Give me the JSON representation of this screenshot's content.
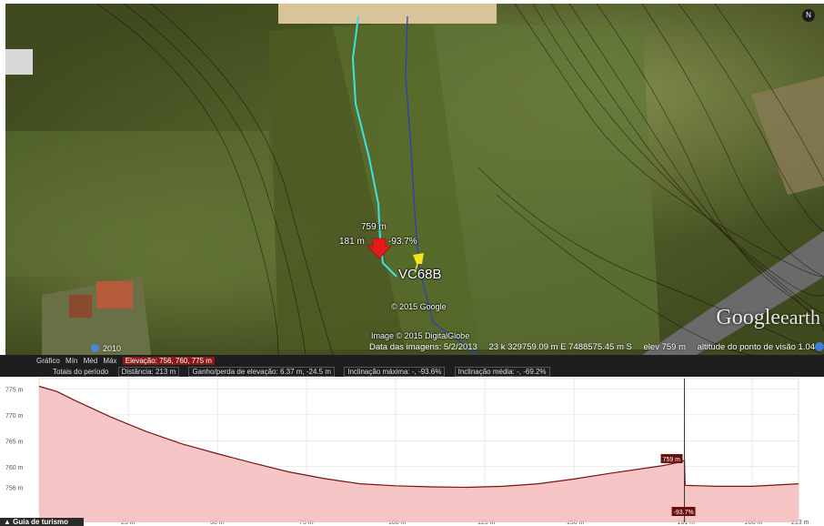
{
  "map": {
    "point_elevation": "759 m",
    "point_distance": "181 m",
    "point_slope": "-93.7%",
    "placemark_label": "VC68B",
    "copyright_google": "© 2015 Google",
    "copyright_imagery": "Image © 2015 DigitalGlobe",
    "logo_main": "Google",
    "logo_sub": "earth",
    "year": "2010",
    "compass_label": "N",
    "status": {
      "imagery_date": "Data das imagens: 5/2/2013",
      "coordinates": "23 k 329759.09 m E 7488575.45 m S",
      "elevation": "elev   759 m",
      "eye_altitude": "altitude do ponto de visão   1.04 km"
    }
  },
  "profile": {
    "row1": {
      "graph_label": "Gráfico",
      "min_label": "Mín",
      "avg_label": "Méd",
      "max_label": "Máx",
      "elevation_values": "Elevação: 756, 760, 775 m"
    },
    "row2": {
      "totals_label": "Totais do período",
      "distance": "Distância: 213 m",
      "gain_loss": "Ganho/perda de elevação: 6.37 m, -24.5 m",
      "max_slope": "Inclinação máxima: -, -93.6%",
      "avg_slope": "Inclinação média: -, -69.2%"
    }
  },
  "chart_data": {
    "type": "area",
    "x_unit": "m",
    "y_unit": "m",
    "x": [
      0,
      5,
      10,
      20,
      30,
      40,
      50,
      60,
      70,
      80,
      90,
      100,
      110,
      120,
      130,
      140,
      150,
      160,
      170,
      175,
      180,
      181,
      181.2,
      190,
      200,
      213
    ],
    "y": [
      775.5,
      774.5,
      772.8,
      769.6,
      766.8,
      764.4,
      762.5,
      760.7,
      759.0,
      757.7,
      756.7,
      756.3,
      756.1,
      756.0,
      756.2,
      756.7,
      757.6,
      758.7,
      759.7,
      760.2,
      760.9,
      761.2,
      756.4,
      756.2,
      756.2,
      756.7
    ],
    "ylim": [
      751,
      777
    ],
    "xlim": [
      0,
      213
    ],
    "y_ticks": [
      {
        "value": 775,
        "label": "775 m"
      },
      {
        "value": 770,
        "label": "770 m"
      },
      {
        "value": 765,
        "label": "765 m"
      },
      {
        "value": 760,
        "label": "760 m"
      },
      {
        "value": 756,
        "label": "756 m"
      }
    ],
    "x_ticks": [
      {
        "value": 25,
        "label": "25 m"
      },
      {
        "value": 50,
        "label": "50 m"
      },
      {
        "value": 75,
        "label": "75 m"
      },
      {
        "value": 100,
        "label": "100 m"
      },
      {
        "value": 125,
        "label": "125 m"
      },
      {
        "value": 150,
        "label": "150 m"
      },
      {
        "value": 181,
        "label": "181 m"
      },
      {
        "value": 200,
        "label": "200 m"
      },
      {
        "value": 213,
        "label": "213 m"
      }
    ],
    "cursor_x": 181,
    "cursor_elevation_label": "759 m",
    "cursor_slope_label": "-93.7%",
    "grid": true,
    "line_color": "#7a1410",
    "fill_color": "#f5bcbc"
  },
  "guide": {
    "tour_guide_label": "Guia de turismo"
  },
  "colors": {
    "route_cyan": "#3fe0e0",
    "route_blue": "#2f3fbf",
    "marker_red": "#e31b1b",
    "pin_yellow": "#f2e51a"
  }
}
